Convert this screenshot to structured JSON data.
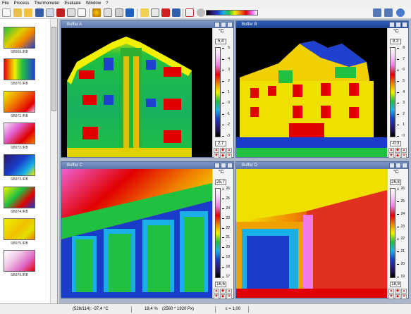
{
  "menu": [
    "File",
    "Process",
    "Thermometer",
    "Evaluate",
    "Window",
    "?"
  ],
  "sidebar_items": [
    {
      "label": "SB969.IRB",
      "theme": "building"
    },
    {
      "label": "SB970.IRB",
      "theme": "corner"
    },
    {
      "label": "SB971.IRB",
      "theme": "red"
    },
    {
      "label": "SB972.IRB",
      "theme": "pink"
    },
    {
      "label": "SB973.IRB",
      "theme": "blue"
    },
    {
      "label": "SB974.IRB",
      "theme": "facade"
    },
    {
      "label": "SB975.IRB",
      "theme": "yellow"
    },
    {
      "label": "SB976.IRB",
      "theme": "pinkwhite"
    }
  ],
  "windows": [
    {
      "title": "Buffer A",
      "unit": "°C",
      "max": "5,4",
      "min": "2,7",
      "ticks": [
        "5",
        "4",
        "3",
        "2",
        "1",
        "0",
        "-1",
        "-2",
        "-3"
      ],
      "kind": "facade_a"
    },
    {
      "title": "Buffer B",
      "unit": "°C",
      "max": "8,3",
      "min": "-0,3",
      "ticks": [
        "8",
        "7",
        "6",
        "5",
        "4",
        "3",
        "2",
        "1",
        "0"
      ],
      "kind": "facade_b"
    },
    {
      "title": "Buffer C",
      "unit": "°C",
      "max": "25,7",
      "min": "16,6",
      "ticks": [
        "26",
        "25",
        "24",
        "23",
        "22",
        "21",
        "20",
        "19",
        "18",
        "17"
      ],
      "kind": "interior_c"
    },
    {
      "title": "Buffer D",
      "unit": "°C",
      "max": "26,8",
      "min": "18,9",
      "ticks": [
        "26",
        "25",
        "24",
        "23",
        "22",
        "21",
        "20",
        "19"
      ],
      "kind": "interior_d"
    }
  ],
  "status": {
    "coords": "(528/114): -37,4 °C",
    "zoom": "18,4 %",
    "resolution": "(2560 * 1920 Px)",
    "emissivity": "ε = 1,00"
  },
  "colors": {
    "title_active": "#1b438f",
    "title_inactive": "#5c76a9",
    "background": "#aab6cc"
  }
}
